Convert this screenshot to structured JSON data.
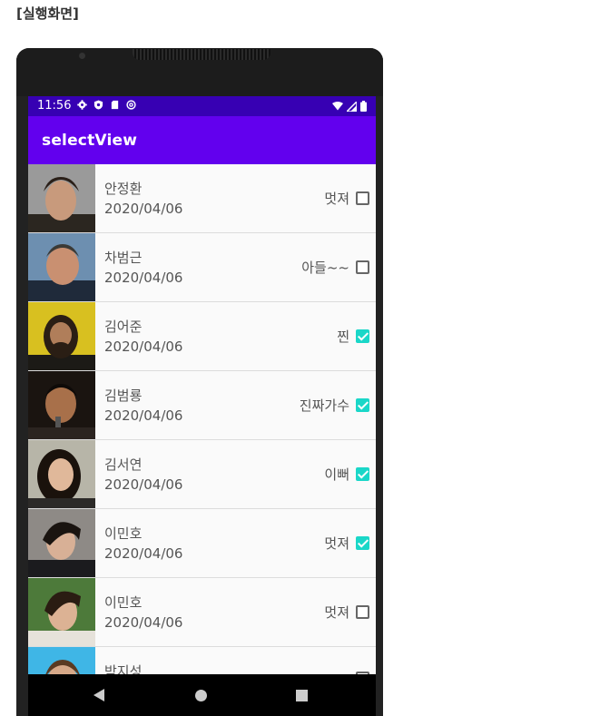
{
  "caption": "[실행화면]",
  "status_bar": {
    "time": "11:56",
    "icons": [
      "gear-icon",
      "shield-icon",
      "sd-card-icon",
      "at-sign-icon"
    ],
    "right_icons": [
      "wifi-icon",
      "signal-icon",
      "battery-icon"
    ]
  },
  "app_bar": {
    "title": "selectView"
  },
  "colors": {
    "status_bar": "#3700b3",
    "app_bar": "#6200ee",
    "checkbox_checked": "#1ad7c8"
  },
  "items": [
    {
      "name": "안정환",
      "date": "2020/04/06",
      "comment": "멋져",
      "checked": false
    },
    {
      "name": "차범근",
      "date": "2020/04/06",
      "comment": "아들~~",
      "checked": false
    },
    {
      "name": "김어준",
      "date": "2020/04/06",
      "comment": "찐",
      "checked": true
    },
    {
      "name": "김범룡",
      "date": "2020/04/06",
      "comment": "진짜가수",
      "checked": true
    },
    {
      "name": "김서연",
      "date": "2020/04/06",
      "comment": "이뻐",
      "checked": true
    },
    {
      "name": "이민호",
      "date": "2020/04/06",
      "comment": "멋져",
      "checked": true
    },
    {
      "name": "이민호",
      "date": "2020/04/06",
      "comment": "멋져",
      "checked": false
    },
    {
      "name": "박지성",
      "date": "",
      "comment": "",
      "checked": false
    }
  ],
  "nav_bar": {
    "icons": [
      "back-icon",
      "home-icon",
      "recents-icon"
    ]
  }
}
